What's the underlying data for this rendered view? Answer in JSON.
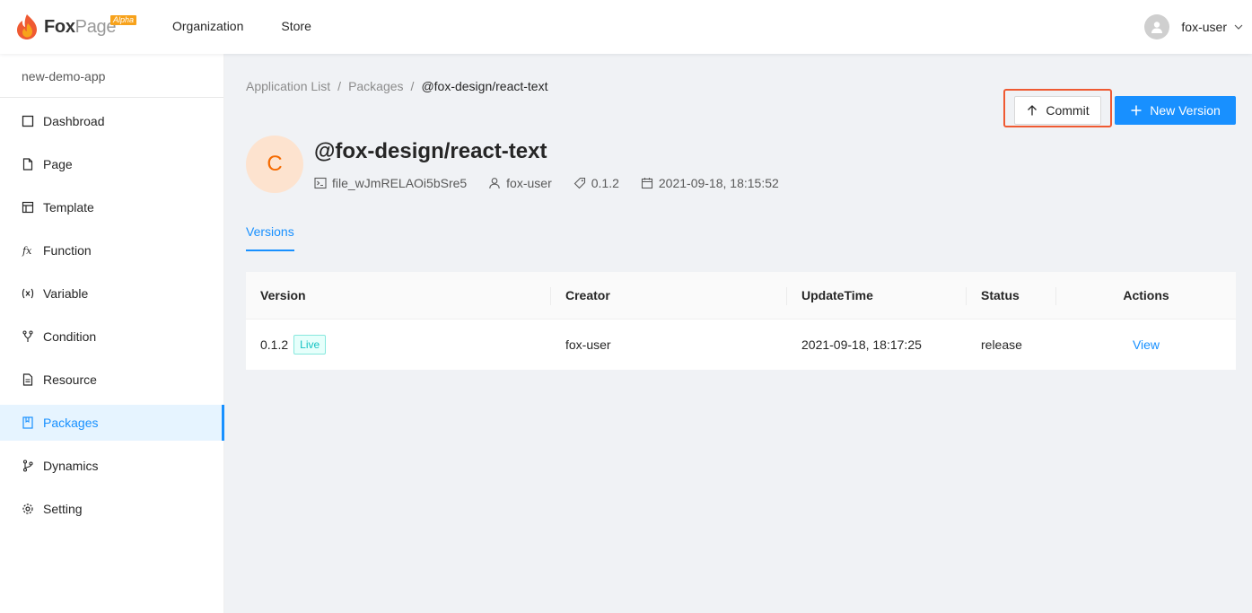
{
  "header": {
    "logo_fox": "Fox",
    "logo_page": "Page",
    "logo_badge": "Alpha",
    "nav": [
      "Organization",
      "Store"
    ],
    "user": "fox-user"
  },
  "sidebar": {
    "app_name": "new-demo-app",
    "items": [
      {
        "label": "Dashbroad",
        "icon": "dashboard-icon"
      },
      {
        "label": "Page",
        "icon": "file-icon"
      },
      {
        "label": "Template",
        "icon": "layout-icon"
      },
      {
        "label": "Function",
        "icon": "function-icon"
      },
      {
        "label": "Variable",
        "icon": "variable-icon"
      },
      {
        "label": "Condition",
        "icon": "branch-icon"
      },
      {
        "label": "Resource",
        "icon": "file-text-icon"
      },
      {
        "label": "Packages",
        "icon": "book-icon",
        "active": true
      },
      {
        "label": "Dynamics",
        "icon": "branches-icon"
      },
      {
        "label": "Setting",
        "icon": "gear-icon"
      }
    ]
  },
  "breadcrumb": {
    "items": [
      "Application List",
      "Packages",
      "@fox-design/react-text"
    ]
  },
  "actions": {
    "commit_label": "Commit",
    "new_version_label": "New Version"
  },
  "package": {
    "avatar_letter": "C",
    "title": "@fox-design/react-text",
    "file_id": "file_wJmRELAOi5bSre5",
    "creator": "fox-user",
    "version": "0.1.2",
    "date": "2021-09-18, 18:15:52"
  },
  "tabs": {
    "active": "Versions"
  },
  "table": {
    "columns": [
      "Version",
      "Creator",
      "UpdateTime",
      "Status",
      "Actions"
    ],
    "rows": [
      {
        "version": "0.1.2",
        "tag": "Live",
        "creator": "fox-user",
        "update_time": "2021-09-18, 18:17:25",
        "status": "release",
        "action": "View"
      }
    ]
  },
  "colors": {
    "primary": "#1890ff",
    "highlight": "#ef5a32",
    "avatar_bg": "#fde3cf",
    "avatar_fg": "#f56a00",
    "live_tag": "#13c2c2"
  }
}
